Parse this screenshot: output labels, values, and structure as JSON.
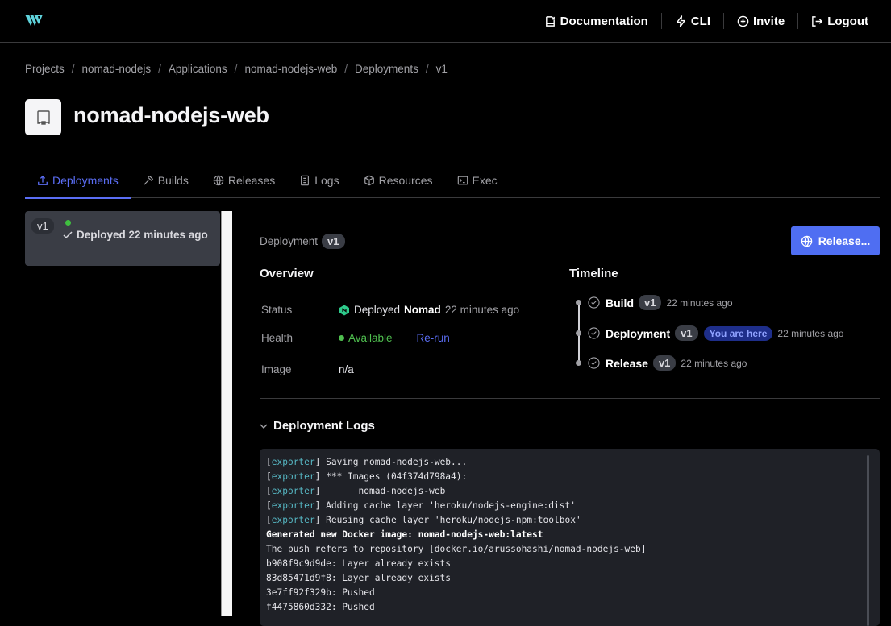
{
  "header": {
    "logo": "waypoint-logo",
    "nav": [
      {
        "label": "Documentation",
        "icon": "documentation-icon"
      },
      {
        "label": "CLI",
        "icon": "lightning-icon"
      },
      {
        "label": "Invite",
        "icon": "plus-circle-icon"
      },
      {
        "label": "Logout",
        "icon": "logout-icon"
      }
    ]
  },
  "breadcrumb": [
    "Projects",
    "nomad-nodejs",
    "Applications",
    "nomad-nodejs-web",
    "Deployments",
    "v1"
  ],
  "app": {
    "title": "nomad-nodejs-web",
    "icon": "application-icon"
  },
  "tabs": [
    {
      "label": "Deployments",
      "icon": "upload-icon",
      "active": true
    },
    {
      "label": "Builds",
      "icon": "hammer-icon",
      "active": false
    },
    {
      "label": "Releases",
      "icon": "globe-icon",
      "active": false
    },
    {
      "label": "Logs",
      "icon": "logs-icon",
      "active": false
    },
    {
      "label": "Resources",
      "icon": "box-icon",
      "active": false
    },
    {
      "label": "Exec",
      "icon": "terminal-icon",
      "active": false
    }
  ],
  "sidebar": {
    "deployments": [
      {
        "version": "v1",
        "status": "Deployed 22 minutes ago",
        "status_color": "#3fbf3f"
      }
    ]
  },
  "deployment": {
    "label": "Deployment",
    "version": "v1",
    "release_button": "Release...",
    "overview": {
      "title": "Overview",
      "status_label": "Status",
      "status_prefix": "Deployed",
      "status_platform": "Nomad",
      "status_time": "22 minutes ago",
      "health_label": "Health",
      "health_value": "Available",
      "rerun_label": "Re-run",
      "image_label": "Image",
      "image_value": "n/a"
    },
    "timeline": {
      "title": "Timeline",
      "items": [
        {
          "name": "Build",
          "version": "v1",
          "time": "22 minutes ago",
          "current": false
        },
        {
          "name": "Deployment",
          "version": "v1",
          "time": "22 minutes ago",
          "current": true,
          "current_label": "You are here"
        },
        {
          "name": "Release",
          "version": "v1",
          "time": "22 minutes ago",
          "current": false
        }
      ]
    },
    "logs": {
      "title": "Deployment Logs",
      "lines": [
        {
          "tag": "exporter",
          "text": " Saving nomad-nodejs-web...",
          "bold": false
        },
        {
          "tag": "exporter",
          "text": " *** Images (04f374d798a4):",
          "bold": false
        },
        {
          "tag": "exporter",
          "text": "       nomad-nodejs-web",
          "bold": false
        },
        {
          "tag": "exporter",
          "text": " Adding cache layer 'heroku/nodejs-engine:dist'",
          "bold": false
        },
        {
          "tag": "exporter",
          "text": " Reusing cache layer 'heroku/nodejs-npm:toolbox'",
          "bold": false
        },
        {
          "tag": "",
          "text": "Generated new Docker image: nomad-nodejs-web:latest",
          "bold": true
        },
        {
          "tag": "",
          "text": "The push refers to repository [docker.io/arussohashi/nomad-nodejs-web]",
          "bold": false
        },
        {
          "tag": "",
          "text": "b908f9c9d9de: Layer already exists",
          "bold": false
        },
        {
          "tag": "",
          "text": "83d85471d9f8: Layer already exists",
          "bold": false
        },
        {
          "tag": "",
          "text": "3e7ff92f329b: Pushed",
          "bold": false
        },
        {
          "tag": "",
          "text": "f4475860d332: Pushed",
          "bold": false
        }
      ]
    }
  },
  "colors": {
    "accent": "#5b6ef5",
    "button": "#4f6ef2",
    "success": "#4fbf4f",
    "logo": "#5fd3dc",
    "log_tag": "#56b6c2"
  }
}
